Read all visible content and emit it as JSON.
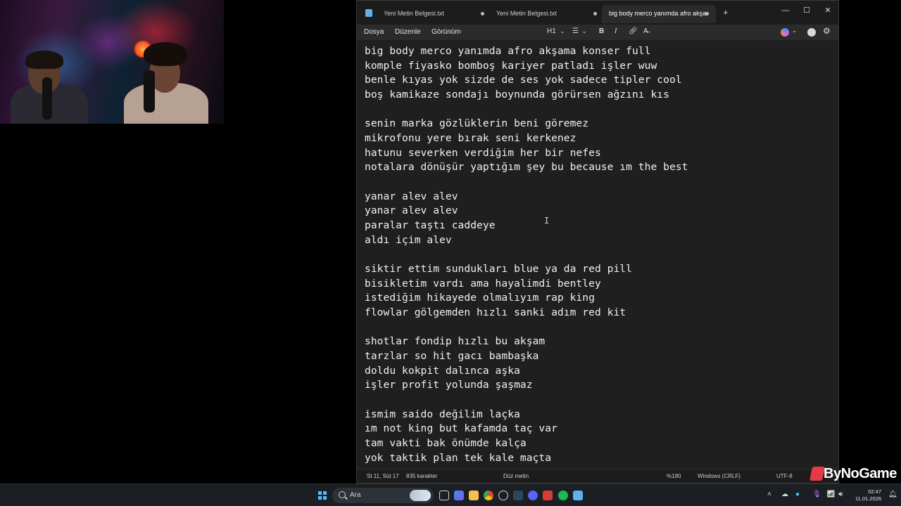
{
  "window": {
    "tabs": [
      {
        "label": "Yeni Metin Belgesi.txt",
        "active": false
      },
      {
        "label": "Yeni Metin Belgesi.txt",
        "active": false
      },
      {
        "label": "big body merco yanımda afro akşa",
        "active": true
      }
    ],
    "add_tab_symbol": "+",
    "controls": {
      "minimize": "—",
      "maximize": "☐",
      "close": "✕"
    }
  },
  "menu": {
    "items": [
      "Dosya",
      "Düzenle",
      "Görünüm"
    ],
    "heading_label": "H1",
    "tools": {
      "bold": "B",
      "italic": "I"
    }
  },
  "editor": {
    "lines": [
      "big body merco yanımda afro akşama konser full",
      "komple fiyasko bomboş kariyer patladı işler wuw",
      "benle kıyas yok sizde de ses yok sadece tipler cool",
      "boş kamikaze sondajı boynunda görürsen ağzını kıs",
      "",
      "senin marka gözlüklerin beni göremez",
      "mikrofonu yere bırak seni kerkenez",
      "hatunu severken verdiğim her bir nefes",
      "notalara dönüşür yaptığım şey bu because ım the best",
      "",
      "yanar alev alev",
      "yanar alev alev",
      "paralar taştı caddeye",
      "aldı içim alev",
      "",
      "siktir ettim sundukları blue ya da red pill",
      "bisikletim vardı ama hayalimdi bentley",
      "istediğim hikayede olmalıyım rap king",
      "flowlar gölgemden hızlı sanki adım red kit",
      "",
      "shotlar fondip hızlı bu akşam",
      "tarzlar so hit gacı bambaşka",
      "doldu kokpit dalınca aşka",
      "işler profit yolunda şaşmaz",
      "",
      "ismim saido değilim laçka",
      "ım not king but kafamda taç var",
      "tam vakti bak önümde kalça",
      "yok taktik plan tek kale maçta"
    ]
  },
  "status": {
    "position": "St 11, Süt 17",
    "chars": "835 karakter",
    "mode": "Düz metin",
    "zoom": "%180",
    "line_ending": "Windows (CRLF)",
    "encoding": "UTF-8"
  },
  "watermark": {
    "text": "ByNoGame"
  },
  "taskbar": {
    "search_label": "Ara",
    "time": "02:47",
    "date": "11.01.2026"
  }
}
